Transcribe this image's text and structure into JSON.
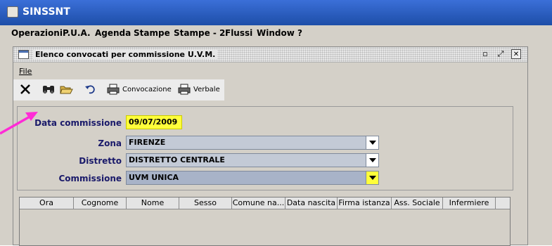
{
  "app": {
    "title": "SINSSNT"
  },
  "menu": [
    "Operazioni",
    "P.U.A.",
    "Agenda",
    "Stampe",
    "Stampe - 2",
    "Flussi",
    "Window",
    "?"
  ],
  "frame": {
    "title": "Elenco convocati per commissione U.V.M.",
    "menu_file": "File"
  },
  "toolbar": {
    "convocazione_label": "Convocazione",
    "verbale_label": "Verbale"
  },
  "form": {
    "data_label": "Data commissione",
    "data_value": "09/07/2009",
    "zona_label": "Zona",
    "zona_value": "FIRENZE",
    "distretto_label": "Distretto",
    "distretto_value": "DISTRETTO CENTRALE",
    "commissione_label": "Commissione",
    "commissione_value": "UVM UNICA"
  },
  "table": {
    "columns": [
      "Ora",
      "Cognome",
      "Nome",
      "Sesso",
      "Comune na...",
      "Data nascita",
      "Firma istanza",
      "Ass. Sociale",
      "Infermiere"
    ]
  },
  "colors": {
    "highlight_yellow": "#ffff3a",
    "annotation_arrow": "#ff2bd6",
    "label_blue": "#1a1a6a"
  }
}
